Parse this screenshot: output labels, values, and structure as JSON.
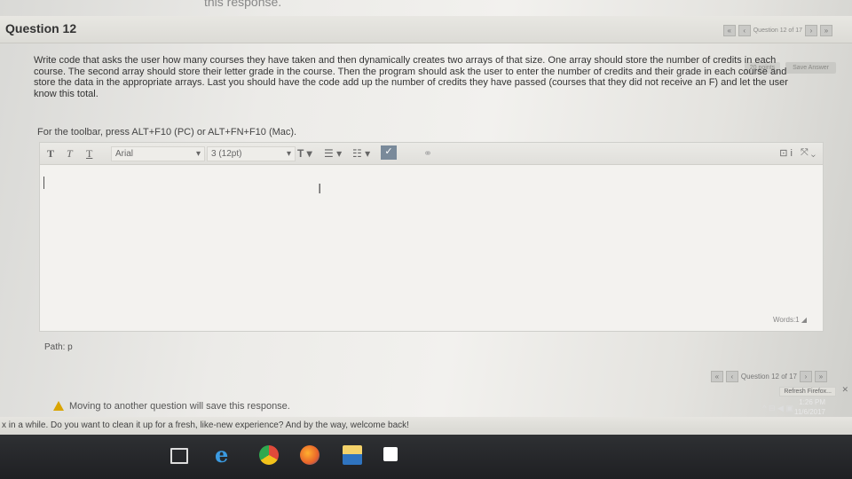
{
  "top_message": "this response.",
  "question": {
    "title": "Question 12",
    "nav_label": "Question 12 of 17",
    "points": "20 points",
    "save_answer": "Save Answer",
    "text_lines": [
      "Write code that asks the user how many courses they have taken and then dynamically creates two arrays of that size.  One array should store the number of credits in each",
      "course.  The second array should store their letter grade in the course.  Then the program should ask the user to enter the number of credits and their grade in each course and",
      "store the data in the appropriate arrays.  Last you should have the code add up the  number of credits they have passed (courses that they did not receive an F) and let the user",
      "know this total."
    ]
  },
  "toolbar_hint": "For the toolbar, press ALT+F10 (PC) or ALT+FN+F10 (Mac).",
  "editor": {
    "font": "Arial",
    "size": "3 (12pt)",
    "words": "Words:1",
    "path": "Path: p"
  },
  "bottom": {
    "nav_label": "Question 12 of 17",
    "moving_msg": "Moving to another question will save this response.",
    "notice": "x in a while. Do you want to clean it up for a fresh, like-new experience? And by the way, welcome back!",
    "refresh_btn": "Refresh Firefox..."
  },
  "system": {
    "time": "1:26 PM",
    "date": "11/6/2017"
  }
}
